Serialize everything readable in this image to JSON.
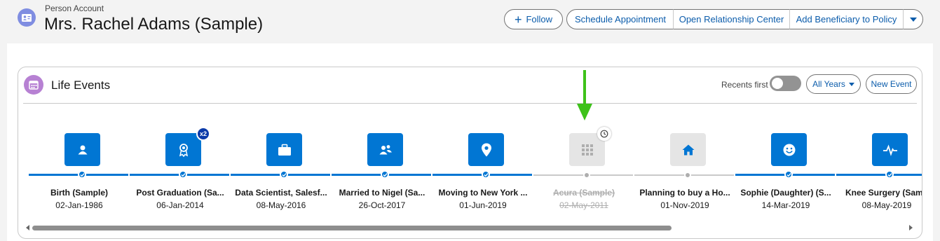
{
  "header": {
    "subtitle": "Person Account",
    "title": "Mrs. Rachel Adams (Sample)",
    "icon": "person-account-icon"
  },
  "actions": {
    "follow_label": "Follow",
    "schedule_label": "Schedule Appointment",
    "relationship_label": "Open Relationship Center",
    "beneficiary_label": "Add Beneficiary to Policy"
  },
  "life_events": {
    "title": "Life Events",
    "recents_label": "Recents first",
    "recents_on": false,
    "years_label": "All Years",
    "new_event_label": "New Event",
    "events": [
      {
        "title": "Birth (Sample)",
        "date": "02-Jan-1986",
        "icon": "person-icon",
        "status": "complete"
      },
      {
        "title": "Post Graduation (Sa...",
        "date": "06-Jan-2014",
        "icon": "award-icon",
        "status": "complete",
        "badge": "x2"
      },
      {
        "title": "Data Scientist, Salesf...",
        "date": "08-May-2016",
        "icon": "briefcase-icon",
        "status": "complete"
      },
      {
        "title": "Married to Nigel (Sa...",
        "date": "26-Oct-2017",
        "icon": "couple-icon",
        "status": "complete"
      },
      {
        "title": "Moving to New York ...",
        "date": "01-Jun-2019",
        "icon": "map-pin-icon",
        "status": "complete"
      },
      {
        "title": "Acura (Sample)",
        "date": "02-May-2011",
        "icon": "grid-icon",
        "status": "cancelled"
      },
      {
        "title": "Planning to buy a Ho...",
        "date": "01-Nov-2019",
        "icon": "home-icon",
        "status": "planned"
      },
      {
        "title": "Sophie (Daughter) (S...",
        "date": "14-Mar-2019",
        "icon": "smiley-icon",
        "status": "complete"
      },
      {
        "title": "Knee Surgery (Samp",
        "date": "08-May-2019",
        "icon": "pulse-icon",
        "status": "complete"
      }
    ]
  },
  "colors": {
    "brand_blue": "#0176d3",
    "link_blue": "#0b5cab",
    "annotation_green": "#3ec21a"
  }
}
